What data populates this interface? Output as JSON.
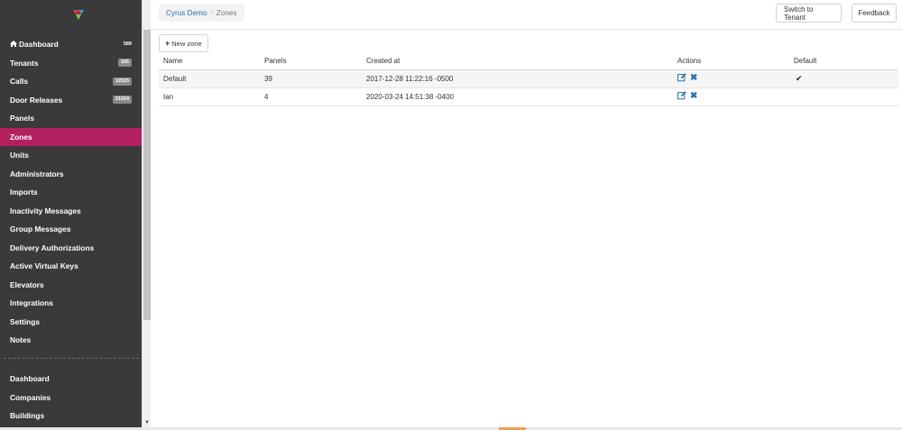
{
  "sidebar": {
    "logo_icon": "brand-logo-icon",
    "active_color": "#b3205f",
    "items": [
      {
        "label": "Dashboard",
        "icon": "home-icon",
        "badge": "589",
        "badge_style": "plain"
      },
      {
        "label": "Tenants",
        "badge": "165"
      },
      {
        "label": "Calls",
        "badge": "12515"
      },
      {
        "label": "Door Releases",
        "badge": "21024"
      },
      {
        "label": "Panels"
      },
      {
        "label": "Zones",
        "active": true
      },
      {
        "label": "Units"
      },
      {
        "label": "Administrators"
      },
      {
        "label": "Imports"
      },
      {
        "label": "Inactivity Messages"
      },
      {
        "label": "Group Messages"
      },
      {
        "label": "Delivery Authorizations"
      },
      {
        "label": "Active Virtual Keys"
      },
      {
        "label": "Elevators"
      },
      {
        "label": "Integrations"
      },
      {
        "label": "Settings"
      },
      {
        "label": "Notes"
      }
    ],
    "items2": [
      {
        "label": "Dashboard"
      },
      {
        "label": "Companies"
      },
      {
        "label": "Buildings"
      }
    ]
  },
  "breadcrumb": {
    "parent": "Cyrus Demo",
    "separator": "/",
    "current": "Zones"
  },
  "header": {
    "switch_label": "Switch to Tenant",
    "feedback_label": "Feedback"
  },
  "toolbar": {
    "new_zone_label": "New zone"
  },
  "table": {
    "columns": [
      "Name",
      "Panels",
      "Created at",
      "Actions",
      "Default"
    ],
    "rows": [
      {
        "name": "Default",
        "panels": "39",
        "created_at": "2017-12-28 11:22:16 -0500",
        "default": true
      },
      {
        "name": "Ian",
        "panels": "4",
        "created_at": "2020-03-24 14:51:38 -0400",
        "default": false
      }
    ]
  }
}
